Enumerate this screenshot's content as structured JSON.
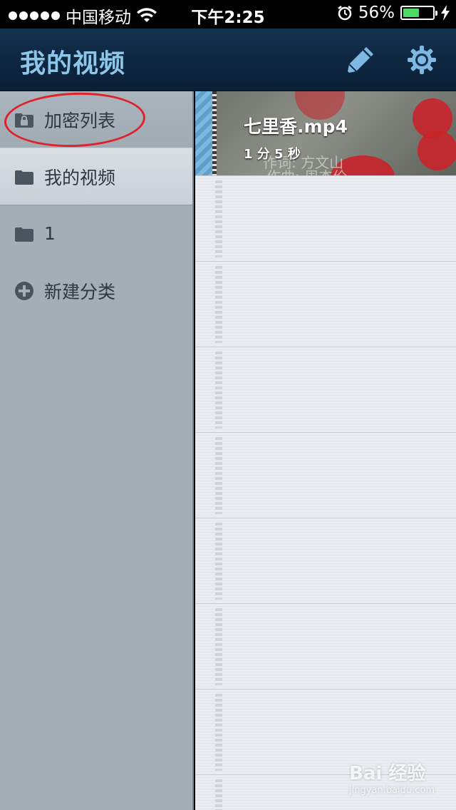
{
  "status_bar": {
    "carrier": "中国移动",
    "time": "下午2:25",
    "battery_percent": "56%"
  },
  "nav": {
    "title": "我的视频",
    "edit_icon": "pencil-icon",
    "settings_icon": "gear-icon"
  },
  "sidebar": {
    "items": [
      {
        "label": "加密列表",
        "icon": "lock-folder-icon"
      },
      {
        "label": "我的视频",
        "icon": "folder-icon"
      },
      {
        "label": "1",
        "icon": "folder-icon"
      },
      {
        "label": "新建分类",
        "icon": "plus-circle-icon"
      }
    ]
  },
  "videos": [
    {
      "title": "七里香.mp4",
      "duration": "1 分 5 秒"
    }
  ],
  "watermark": {
    "text": "Bai 经验",
    "sub": "jingyan.baidu.com"
  },
  "colors": {
    "accent_title": "#8ec6ea",
    "nav_background": "#12304d",
    "highlight_circle": "#e0212b"
  }
}
